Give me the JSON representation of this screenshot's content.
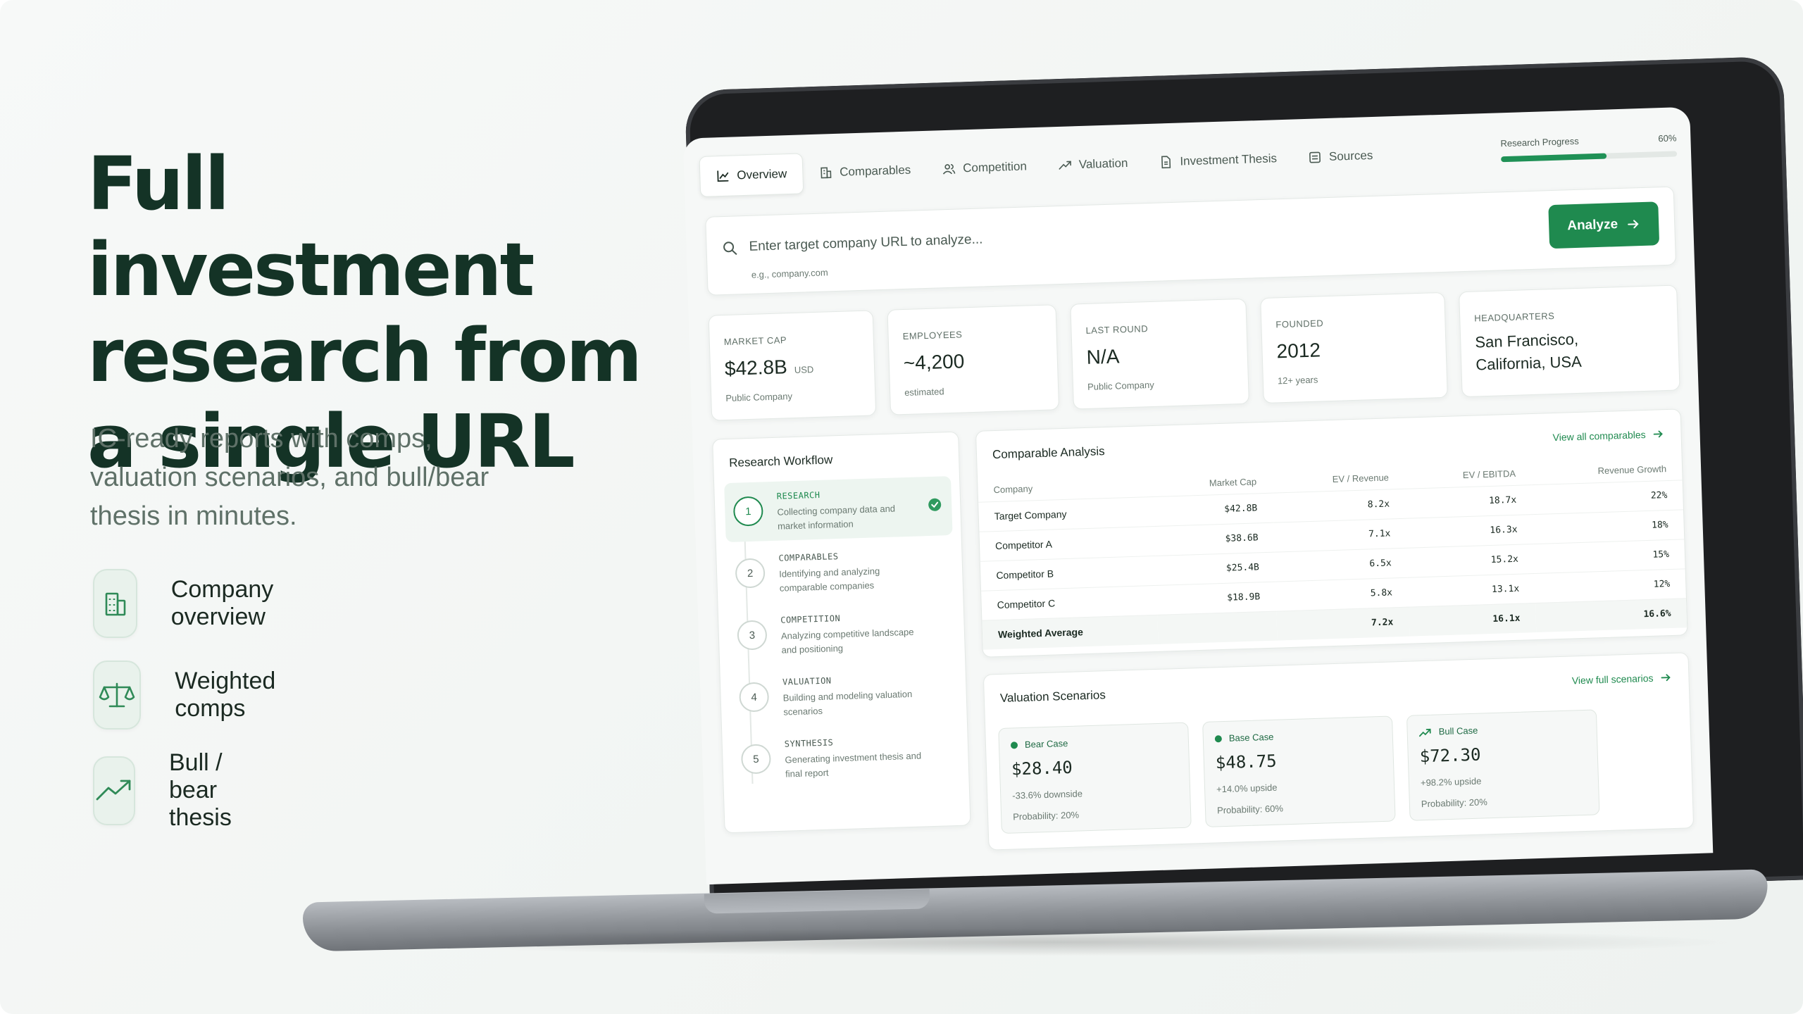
{
  "hero": {
    "title_lines": [
      "Full investment",
      "research from",
      "a single URL"
    ],
    "subtitle": "IC-ready reports with comps, valuation scenarios, and bull/bear thesis in minutes.",
    "features": [
      {
        "icon": "building-icon",
        "label": "Company overview"
      },
      {
        "icon": "scale-icon",
        "label": "Weighted comps"
      },
      {
        "icon": "trending-up-icon",
        "label": "Bull / bear thesis"
      }
    ]
  },
  "nav": {
    "tabs": [
      {
        "icon": "chart-line-icon",
        "label": "Overview",
        "active": true
      },
      {
        "icon": "building-icon",
        "label": "Comparables"
      },
      {
        "icon": "users-icon",
        "label": "Competition"
      },
      {
        "icon": "trending-up-icon",
        "label": "Valuation"
      },
      {
        "icon": "document-icon",
        "label": "Investment Thesis"
      },
      {
        "icon": "list-icon",
        "label": "Sources"
      }
    ],
    "progress": {
      "label": "Research Progress",
      "value_text": "60%",
      "value": 0.6
    }
  },
  "search": {
    "placeholder": "Enter target company URL to analyze...",
    "hint": "e.g., company.com",
    "button_label": "Analyze"
  },
  "stats": [
    {
      "label": "MARKET CAP",
      "value": "$42.8B",
      "unit": "USD",
      "note": "Public Company"
    },
    {
      "label": "EMPLOYEES",
      "value": "~4,200",
      "note": "estimated"
    },
    {
      "label": "LAST ROUND",
      "value": "N/A",
      "note": "Public Company"
    },
    {
      "label": "FOUNDED",
      "value": "2012",
      "note": "12+ years"
    },
    {
      "label": "HEADQUARTERS",
      "value": "San Francisco, California, USA"
    }
  ],
  "workflow": {
    "title": "Research Workflow",
    "steps": [
      {
        "num": "1",
        "name": "RESEARCH",
        "desc": "Collecting company data and market information",
        "active": true
      },
      {
        "num": "2",
        "name": "COMPARABLES",
        "desc": "Identifying and analyzing comparable companies"
      },
      {
        "num": "3",
        "name": "COMPETITION",
        "desc": "Analyzing competitive landscape and positioning"
      },
      {
        "num": "4",
        "name": "VALUATION",
        "desc": "Building and modeling valuation scenarios"
      },
      {
        "num": "5",
        "name": "SYNTHESIS",
        "desc": "Generating investment thesis and final report"
      }
    ]
  },
  "comparables": {
    "title": "Comparable Analysis",
    "link": "View all comparables",
    "headers": [
      "Company",
      "Market Cap",
      "EV / Revenue",
      "EV / EBITDA",
      "Revenue Growth"
    ],
    "rows": [
      [
        "Target Company",
        "$42.8B",
        "8.2x",
        "18.7x",
        "22%"
      ],
      [
        "Competitor A",
        "$38.6B",
        "7.1x",
        "16.3x",
        "18%"
      ],
      [
        "Competitor B",
        "$25.4B",
        "6.5x",
        "15.2x",
        "15%"
      ],
      [
        "Competitor C",
        "$18.9B",
        "5.8x",
        "13.1x",
        "12%"
      ]
    ],
    "average": [
      "Weighted Average",
      "",
      "7.2x",
      "16.1x",
      "16.6%"
    ]
  },
  "valuation": {
    "title": "Valuation Scenarios",
    "link": "View full scenarios",
    "scenarios": [
      {
        "name": "Bear Case",
        "price": "$28.40",
        "change": "-33.6% downside",
        "prob": "Probability: 20%",
        "marker": "dot"
      },
      {
        "name": "Base Case",
        "price": "$48.75",
        "change": "+14.0% upside",
        "prob": "Probability: 60%",
        "marker": "dot"
      },
      {
        "name": "Bull Case",
        "price": "$72.30",
        "change": "+98.2% upside",
        "prob": "Probability: 20%",
        "marker": "trending-up-icon"
      }
    ]
  },
  "colors": {
    "brand": "#1f8a4f",
    "heading": "#143326",
    "accent_bg": "#e9f2ec"
  }
}
